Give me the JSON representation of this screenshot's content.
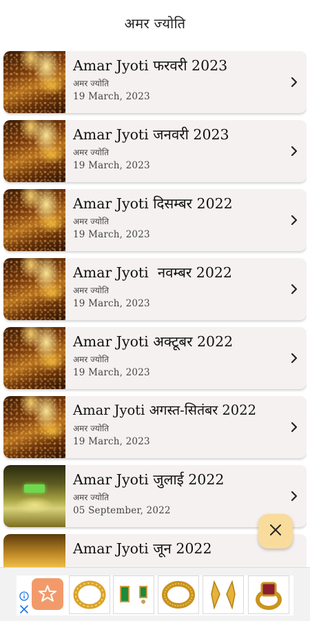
{
  "header": {
    "title": "अमर ज्योति"
  },
  "items": [
    {
      "title": "Amar Jyoti फरवरी 2023",
      "subtitle": "अमर ज्योति",
      "date": "19 March, 2023",
      "thumb": "fire"
    },
    {
      "title": "Amar Jyoti जनवरी 2023",
      "subtitle": "अमर ज्योति",
      "date": "19 March, 2023",
      "thumb": "fire"
    },
    {
      "title": "Amar Jyoti दिसम्बर 2022",
      "subtitle": "अमर ज्योति",
      "date": "19 March, 2023",
      "thumb": "fire"
    },
    {
      "title": "Amar Jyoti  नवम्बर 2022",
      "subtitle": "अमर ज्योति",
      "date": "19 March, 2023",
      "thumb": "fire"
    },
    {
      "title": "Amar Jyoti अक्टूबर 2022",
      "subtitle": "अमर ज्योति",
      "date": "19 March, 2023",
      "thumb": "fire"
    },
    {
      "title": "Amar Jyoti अगस्त-सितंबर 2022",
      "subtitle": "अमर ज्योति",
      "date": "19 March, 2023",
      "thumb": "fire"
    },
    {
      "title": "Amar Jyoti जुलाई 2022",
      "subtitle": "अमर ज्योति",
      "date": "05 September, 2022",
      "thumb": "temple"
    },
    {
      "title": "Amar Jyoti जून 2022",
      "subtitle": "",
      "date": "",
      "thumb": "gold"
    }
  ],
  "icons": {
    "chevron": "chevron-right-icon",
    "fab": "close-icon",
    "ad_info": "info-icon",
    "ad_close": "close-icon"
  },
  "colors": {
    "card_bg": "#f6f1f1",
    "fab_bg": "#f9dc9c",
    "ad_logo_bg": "#f39a6b",
    "ad_icon_blue": "#1a73e8"
  }
}
